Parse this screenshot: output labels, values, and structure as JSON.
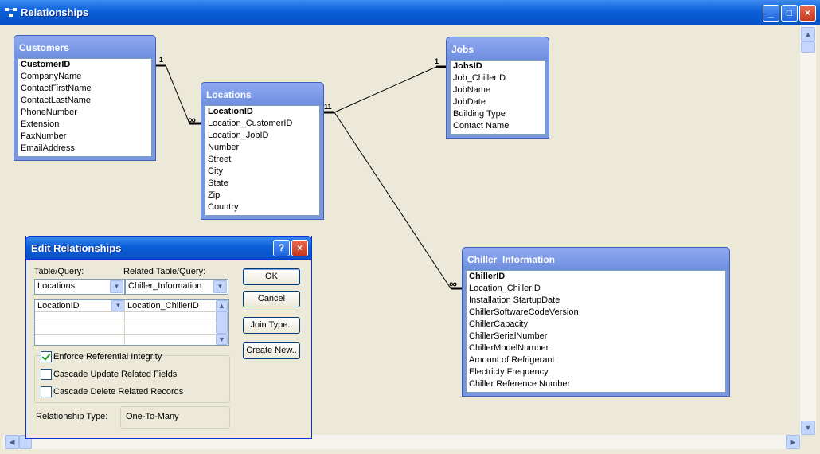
{
  "window": {
    "title": "Relationships",
    "minimize": "_",
    "maximize": "□",
    "close": "×"
  },
  "tables": {
    "customers": {
      "title": "Customers",
      "fields": [
        "CustomerID",
        "CompanyName",
        "ContactFirstName",
        "ContactLastName",
        "PhoneNumber",
        "Extension",
        "FaxNumber",
        "EmailAddress"
      ]
    },
    "locations": {
      "title": "Locations",
      "fields": [
        "LocationID",
        "Location_CustomerID",
        "Location_JobID",
        "Number",
        "Street",
        "City",
        "State",
        "Zip",
        "Country"
      ]
    },
    "jobs": {
      "title": "Jobs",
      "fields": [
        "JobsID",
        "Job_ChillerID",
        "JobName",
        "JobDate",
        "Building Type",
        "Contact Name"
      ]
    },
    "chiller": {
      "title": "Chiller_Information",
      "fields": [
        "ChillerID",
        "Location_ChillerID",
        "Installation StartupDate",
        "ChillerSoftwareCodeVersion",
        "ChillerCapacity",
        "ChillerSerialNumber",
        "ChillerModelNumber",
        "Amount of Refrigerant",
        "Electricty Frequency",
        "Chiller Reference Number"
      ]
    }
  },
  "relationships": {
    "one": "1",
    "many": "∞",
    "one_one": "11"
  },
  "dialog": {
    "title": "Edit Relationships",
    "help": "?",
    "close": "×",
    "table_label": "Table/Query:",
    "related_label": "Related Table/Query:",
    "table_value": "Locations",
    "related_value": "Chiller_Information",
    "grid_left": "LocationID",
    "grid_right": "Location_ChillerID",
    "ok": "OK",
    "cancel": "Cancel",
    "join_type": "Join Type..",
    "create_new": "Create New..",
    "enforce": "Enforce Referential Integrity",
    "cascade_update": "Cascade Update Related Fields",
    "cascade_delete": "Cascade Delete Related Records",
    "rel_type_label": "Relationship Type:",
    "rel_type_value": "One-To-Many"
  },
  "icons": {
    "dropdown": "▼",
    "scroll_up": "▲",
    "scroll_down": "▼",
    "scroll_left": "◀",
    "scroll_right": "▶"
  }
}
